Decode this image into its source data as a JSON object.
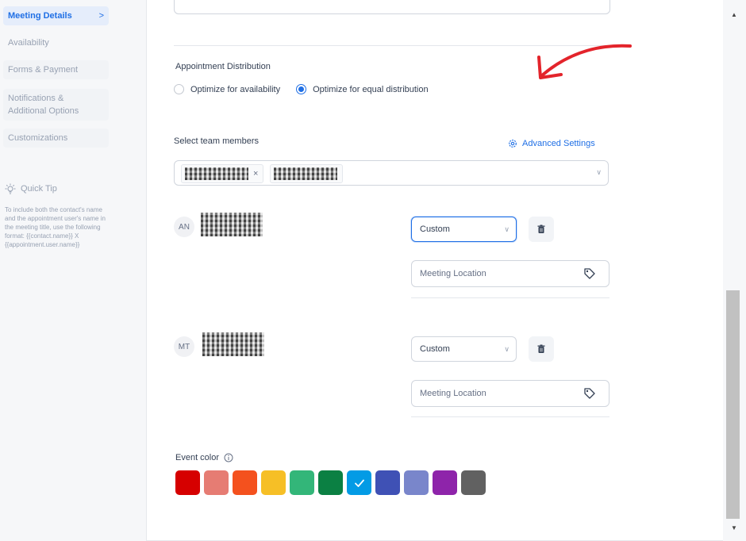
{
  "sidebar": {
    "items": [
      {
        "label": "Meeting Details",
        "active": true
      },
      {
        "label": "Availability"
      },
      {
        "label": "Forms & Payment"
      },
      {
        "label": "Notifications & Additional Options"
      },
      {
        "label": "Customizations"
      }
    ],
    "active_chevron": ">",
    "quick_tip": {
      "title": "Quick Tip",
      "text": "To include both the contact's name and the appointment user's name in the meeting title, use the following format: {{contact.name}} X {{appointment.user.name}}"
    }
  },
  "distribution": {
    "title": "Appointment Distribution",
    "options": [
      {
        "label": "Optimize for availability",
        "selected": false
      },
      {
        "label": "Optimize for equal distribution",
        "selected": true
      }
    ]
  },
  "team": {
    "label": "Select team members",
    "advanced_settings": "Advanced Settings",
    "chip_remove": "×",
    "members": [
      {
        "initials": "AN",
        "location_type": "Custom",
        "location_placeholder": "Meeting Location"
      },
      {
        "initials": "MT",
        "location_type": "Custom",
        "location_placeholder": "Meeting Location"
      }
    ]
  },
  "event_color": {
    "label": "Event color",
    "colors": [
      "#d60000",
      "#e67c73",
      "#f4511e",
      "#f6bf26",
      "#33b679",
      "#0b8043",
      "#039be5",
      "#3f51b5",
      "#7986cb",
      "#8e24aa",
      "#616161"
    ],
    "selected_index": 6
  },
  "accent": "#1f6fe5"
}
